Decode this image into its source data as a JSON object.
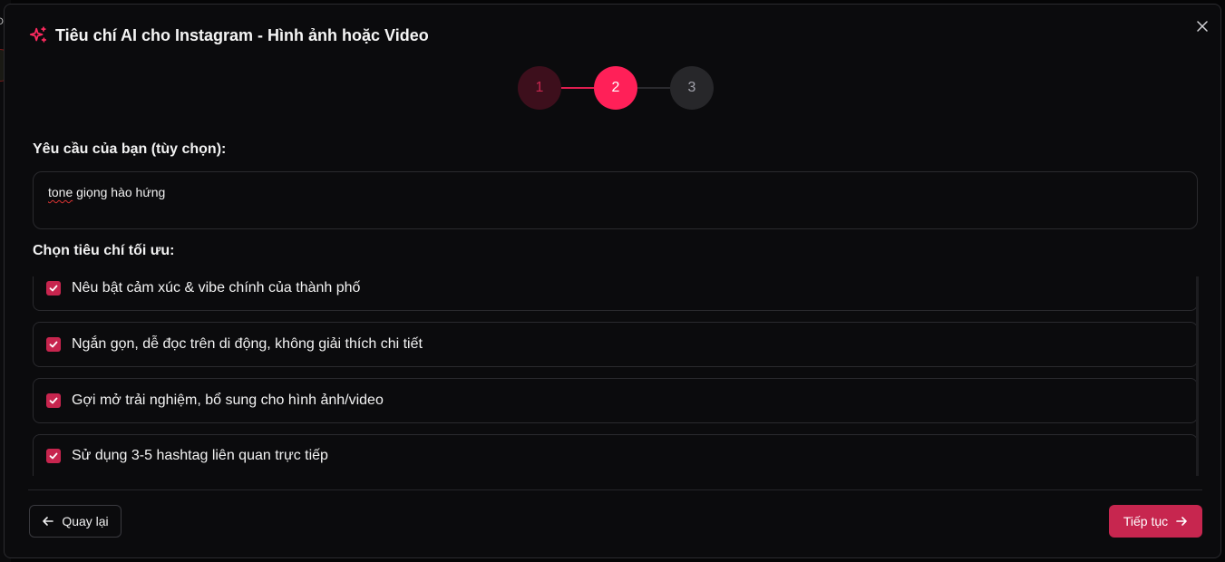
{
  "background": {
    "partial_text": "Đa"
  },
  "modal": {
    "title": "Tiêu chí AI cho Instagram - Hình ảnh hoặc Video",
    "title_icon": "sparkles-icon",
    "close_icon": "close-icon",
    "accent_color": "#c7264f"
  },
  "stepper": {
    "current_step": 2,
    "steps": [
      {
        "label": "1",
        "state": "completed"
      },
      {
        "label": "2",
        "state": "active"
      },
      {
        "label": "3",
        "state": "upcoming"
      }
    ]
  },
  "request": {
    "label": "Yêu cầu của bạn (tùy chọn):",
    "value_underlined": "tone",
    "value_rest": " giọng hào hứng"
  },
  "criteria": {
    "label": "Chọn tiêu chí tối ưu:",
    "items": [
      {
        "label": "Nêu bật cảm xúc & vibe chính của thành phố",
        "checked": true
      },
      {
        "label": "Ngắn gọn, dễ đọc trên di động, không giải thích chi tiết",
        "checked": true
      },
      {
        "label": "Gợi mở trải nghiệm, bổ sung cho hình ảnh/video",
        "checked": true
      },
      {
        "label": "Sử dụng 3-5 hashtag liên quan trực tiếp",
        "checked": true
      }
    ]
  },
  "footer": {
    "back_label": "Quay lại",
    "next_label": "Tiếp tục"
  }
}
